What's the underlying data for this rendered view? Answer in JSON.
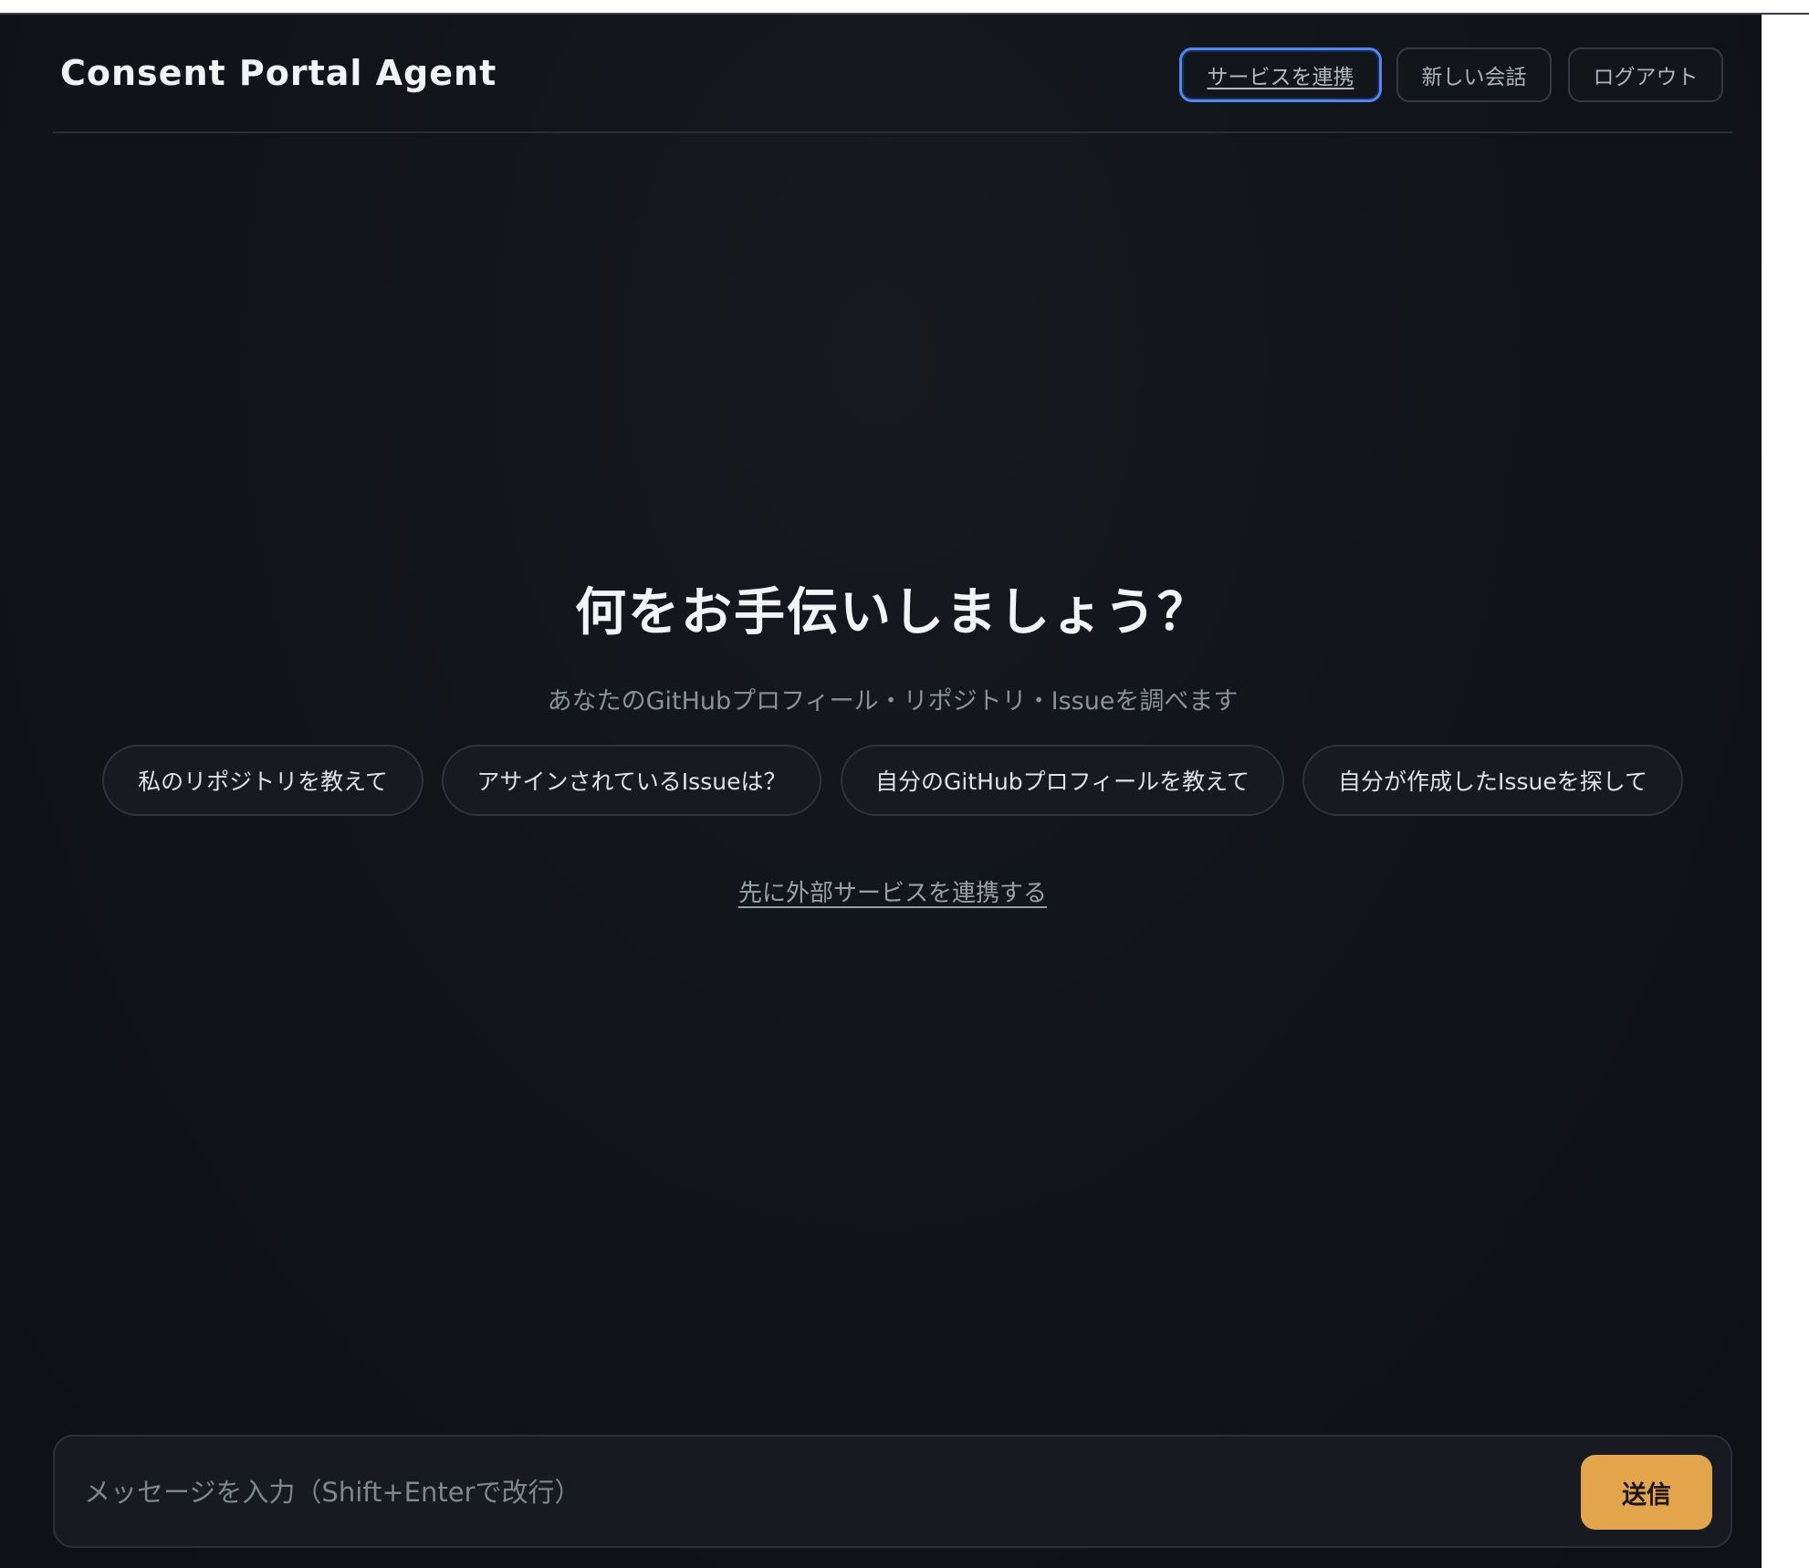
{
  "header": {
    "brand": "Consent Portal Agent",
    "buttons": {
      "connect": "サービスを連携",
      "new_chat": "新しい会話",
      "logout": "ログアウト"
    }
  },
  "hero": {
    "title": "何をお手伝いしましょう？",
    "subtitle": "あなたのGitHubプロフィール・リポジトリ・Issueを調べます"
  },
  "suggestions": [
    "私のリポジトリを教えて",
    "アサインされているIssueは？",
    "自分のGitHubプロフィールを教えて",
    "自分が作成したIssueを探して"
  ],
  "connect_link": "先に外部サービスを連携する",
  "composer": {
    "placeholder": "メッセージを入力（Shift+Enterで改行）",
    "send_label": "送信"
  },
  "colors": {
    "background": "#0e1116",
    "accent": "#e2a54b",
    "focus_ring": "#4f88f5"
  }
}
